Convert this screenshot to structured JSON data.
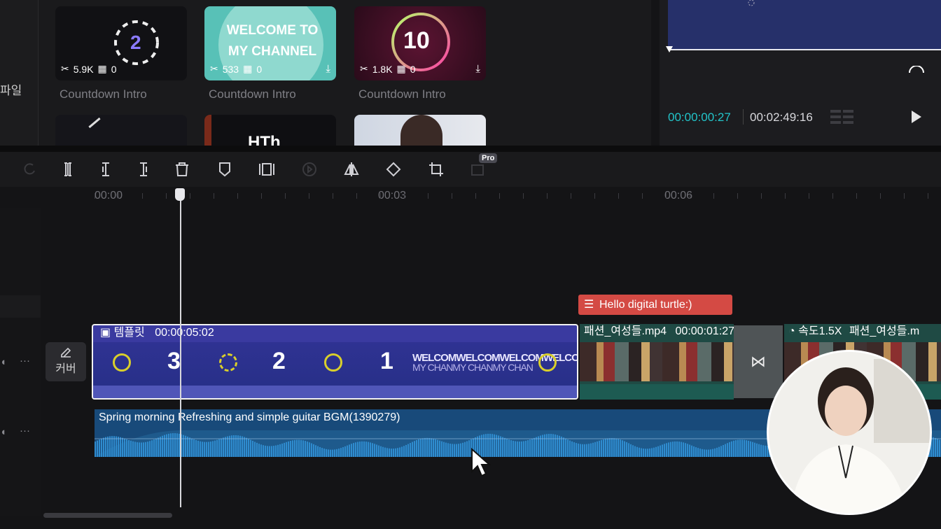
{
  "left_panel": {
    "partial_label": "파일"
  },
  "library": {
    "cards": [
      {
        "title": "Countdown Intro",
        "thumb_text": "2",
        "uses": "5.9K",
        "items": "0",
        "bg": "#111114",
        "accent": "#8b7bff"
      },
      {
        "title": "Countdown Intro",
        "thumb_text": "WELCOME TO MY CHANNEL",
        "uses": "533",
        "items": "0",
        "bg": "#58c1b7",
        "accent": "#ffffff"
      },
      {
        "title": "Countdown Intro",
        "thumb_text": "10",
        "uses": "1.8K",
        "items": "0",
        "bg": "#3a0f25",
        "accent": "#b6ff6a"
      }
    ],
    "second_row_partial": [
      "",
      "HTh",
      ""
    ]
  },
  "preview": {
    "current_time": "00:00:00:27",
    "total_time": "00:02:49:16",
    "accent": "#22c4c9"
  },
  "toolbar": {
    "pro_badge": "Pro"
  },
  "timeline": {
    "ruler_labels": [
      "00:00",
      "00:03",
      "00:06"
    ],
    "cover_label": "커버",
    "track_menu": "···",
    "template_clip": {
      "label": "템플릿",
      "duration": "00:00:05:02",
      "countdown": [
        "3",
        "2",
        "1"
      ],
      "welcome_text": "WELCOMWELCOMWELCOMWELCOMP",
      "welcome_sub": "MY CHANMY CHANMY CHAN"
    },
    "video_clip_1": {
      "name": "패션_여성들.mp4",
      "duration": "00:00:01:27"
    },
    "video_clip_2": {
      "speed": "속도1.5X",
      "name": "패션_여성들.m"
    },
    "transition_icon": "⋈",
    "text_clip": {
      "label": "Hello digital turtle:)"
    },
    "audio_clip": {
      "label": "Spring morning Refreshing and simple guitar BGM(1390279)"
    }
  }
}
